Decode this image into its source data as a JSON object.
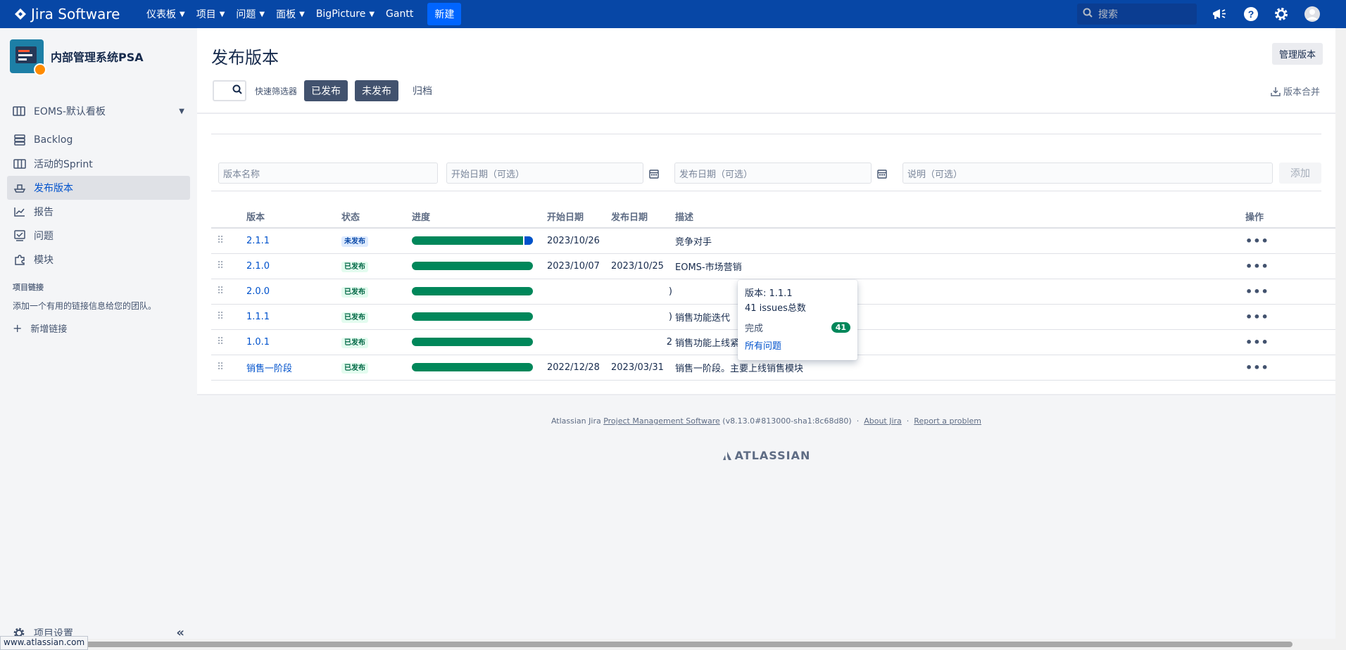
{
  "app": {
    "name": "Jira Software"
  },
  "topnav": {
    "items": [
      {
        "label": "仪表板",
        "dropdown": true
      },
      {
        "label": "项目",
        "dropdown": true
      },
      {
        "label": "问题",
        "dropdown": true
      },
      {
        "label": "面板",
        "dropdown": true
      },
      {
        "label": "BigPicture",
        "dropdown": true
      },
      {
        "label": "Gantt",
        "dropdown": false
      }
    ],
    "create_label": "新建",
    "search_placeholder": "搜索",
    "icons": [
      "megaphone-icon",
      "help-icon",
      "settings-icon",
      "avatar-icon"
    ]
  },
  "sidebar": {
    "project_name": "内部管理系统PSA",
    "board_selector": "EOMS-默认看板",
    "items": [
      {
        "label": "Backlog",
        "icon": "backlog-icon"
      },
      {
        "label": "活动的Sprint",
        "icon": "board-icon"
      },
      {
        "label": "发布版本",
        "icon": "ship-icon",
        "active": true
      },
      {
        "label": "报告",
        "icon": "chart-icon"
      },
      {
        "label": "问题",
        "icon": "issues-icon"
      },
      {
        "label": "模块",
        "icon": "puzzle-icon"
      }
    ],
    "links_heading": "项目链接",
    "links_text": "添加一个有用的链接信息给您的团队。",
    "add_link_label": "新增链接",
    "settings_label": "项目设置"
  },
  "main": {
    "title": "发布版本",
    "manage_label": "管理版本",
    "quick_filter_label": "快速筛选器",
    "filters": [
      {
        "label": "已发布",
        "on": true
      },
      {
        "label": "未发布",
        "on": true
      },
      {
        "label": "归档",
        "on": false
      }
    ],
    "merge_label": "版本合并",
    "form": {
      "name_placeholder": "版本名称",
      "start_placeholder": "开始日期（可选）",
      "release_placeholder": "发布日期（可选）",
      "desc_placeholder": "说明（可选）",
      "add_label": "添加"
    },
    "columns": [
      "版本",
      "状态",
      "进度",
      "开始日期",
      "发布日期",
      "描述",
      "操作"
    ],
    "rows": [
      {
        "version": "2.1.1",
        "status": "未发布",
        "status_type": "unreleased",
        "progress_done": 0.92,
        "start": "2023/10/26",
        "release": "",
        "desc": "竞争对手"
      },
      {
        "version": "2.1.0",
        "status": "已发布",
        "status_type": "released",
        "progress_done": 1.0,
        "start": "2023/10/07",
        "release": "2023/10/25",
        "desc": "EOMS-市场营销"
      },
      {
        "version": "2.0.0",
        "status": "已发布",
        "status_type": "released",
        "progress_done": 1.0,
        "start": "",
        "release": ")",
        "desc": ""
      },
      {
        "version": "1.1.1",
        "status": "已发布",
        "status_type": "released",
        "progress_done": 1.0,
        "start": "",
        "release": ")",
        "desc": "销售功能迭代"
      },
      {
        "version": "1.0.1",
        "status": "已发布",
        "status_type": "released",
        "progress_done": 1.0,
        "start": "",
        "release": "2",
        "desc": "销售功能上线紧急优化"
      },
      {
        "version": "销售一阶段",
        "status": "已发布",
        "status_type": "released",
        "progress_done": 1.0,
        "start": "2022/12/28",
        "release": "2023/03/31",
        "desc": "销售一阶段。主要上线销售模块"
      }
    ],
    "tooltip": {
      "version_line": "版本: 1.1.1",
      "issues_line": "41 issues总数",
      "done_label": "完成",
      "done_count": "41",
      "all_issues_label": "所有问题"
    }
  },
  "footer": {
    "prefix": "Atlassian Jira",
    "pms_link": "Project Management Software",
    "version": "(v8.13.0#813000-sha1:8c68d80)",
    "about_link": "About Jira",
    "report_link": "Report a problem",
    "logo_text": "ATLASSIAN"
  },
  "status_url": "www.atlassian.com",
  "colors": {
    "topnav": "#0747a6",
    "create": "#0065ff",
    "progress_done": "#00875a",
    "progress_todo": "#0052cc",
    "link": "#0052cc"
  }
}
